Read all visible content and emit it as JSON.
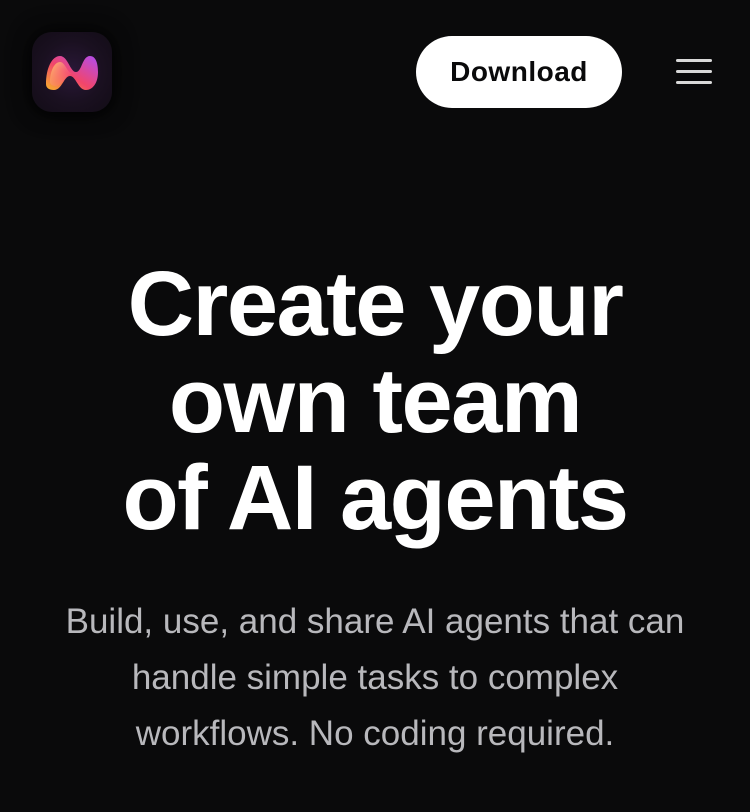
{
  "header": {
    "logo_icon": "gradient-wave-logo-icon",
    "download_label": "Download",
    "menu_icon": "hamburger-menu-icon"
  },
  "hero": {
    "title_lines": [
      "Create your",
      "own team",
      "of AI agents"
    ],
    "subtitle_lines": [
      "Build, use, and share AI agents that can",
      "handle simple tasks to complex",
      "workflows. No coding required."
    ]
  },
  "colors": {
    "background": "#0a0a0b",
    "button_bg": "#ffffff",
    "button_text": "#0a0a0b",
    "subtitle_text": "#b8b8bc",
    "logo_gradient": [
      "#f5a623",
      "#f0306a",
      "#a04bf0"
    ]
  }
}
